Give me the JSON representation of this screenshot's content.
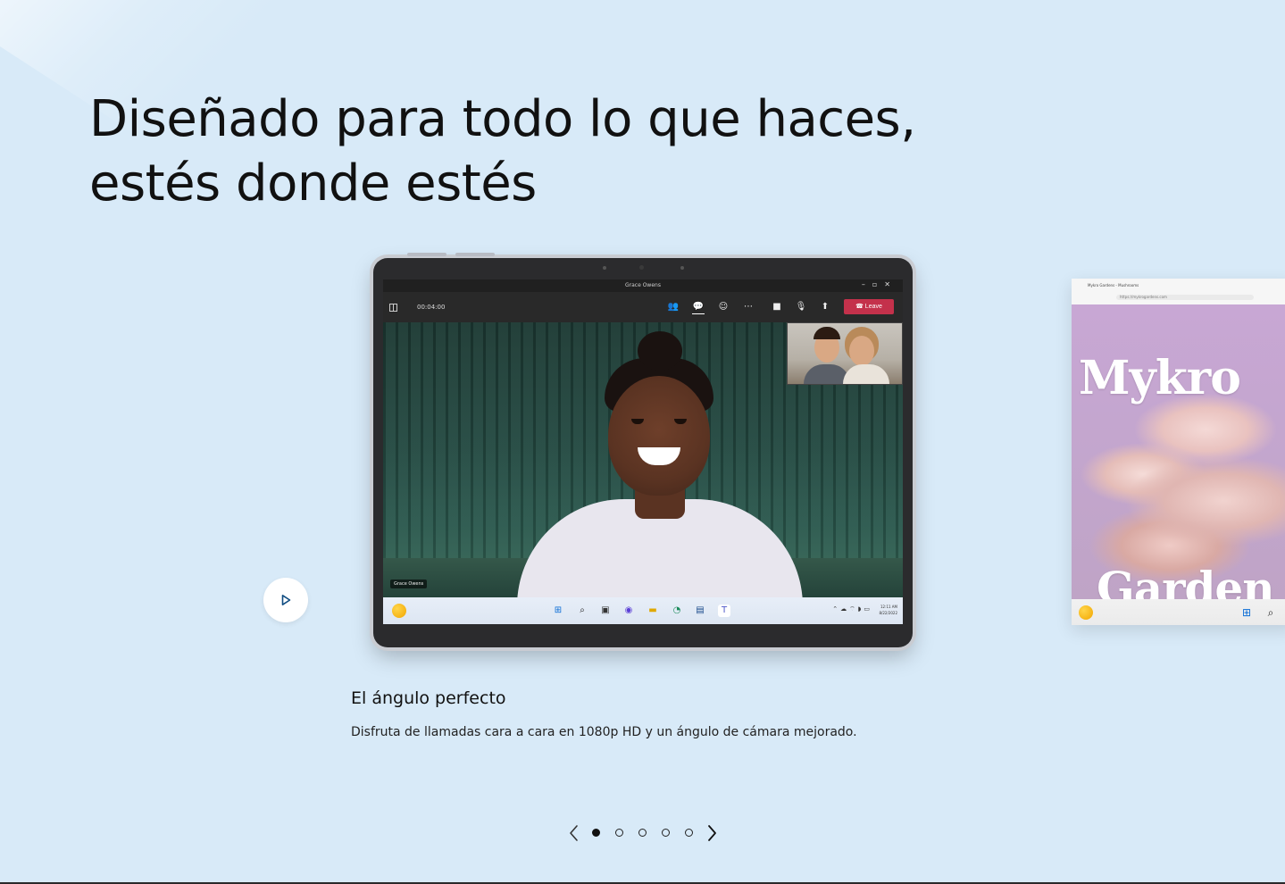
{
  "headline": {
    "line1": "Diseñado para todo lo que haces,",
    "line2": "estés donde estés"
  },
  "slide": {
    "title": "El ángulo perfecto",
    "description": "Disfruta de llamadas cara a cara en 1080p HD y un ángulo de cámara mejorado."
  },
  "teams_call": {
    "window_title": "Grace Owens",
    "timer": "00:04:00",
    "leave_label": "Leave",
    "participant_name": "Grace Owens",
    "clock_time": "12:11 AM",
    "clock_date": "8/22/2022"
  },
  "peek_card": {
    "tab_title": "Mykro Gardens - Mushrooms",
    "url": "https://mykrogardens.com",
    "title_line1": "Mykro",
    "title_line2": "Garden"
  },
  "carousel": {
    "slide_count": 5,
    "active_index": 0
  },
  "icons": {
    "play": "play-icon",
    "prev": "chevron-left-icon",
    "next": "chevron-right-icon"
  },
  "colors": {
    "page_background": "#d8eaf8",
    "leave_button": "#c4314b",
    "text": "#111111"
  }
}
